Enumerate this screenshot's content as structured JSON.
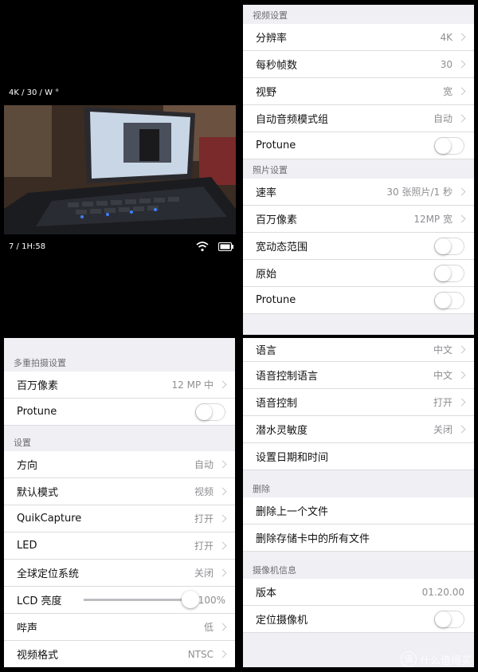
{
  "camera": {
    "mode_info": "4K / 30 / W °",
    "status_info": "7 / 1H:58",
    "wifi_icon": "wifi-icon",
    "battery_icon": "battery-icon"
  },
  "video_settings": {
    "header": "视频设置",
    "rows": [
      {
        "label": "分辨率",
        "value": "4K"
      },
      {
        "label": "每秒帧数",
        "value": "30"
      },
      {
        "label": "视野",
        "value": "宽"
      },
      {
        "label": "自动音频模式组",
        "value": "自动"
      }
    ],
    "protune_label": "Protune"
  },
  "photo_settings": {
    "header": "照片设置",
    "rows": [
      {
        "label": "速率",
        "value": "30 张照片/1 秒"
      },
      {
        "label": "百万像素",
        "value": "12MP 宽"
      }
    ],
    "toggles": [
      "宽动态范围",
      "原始",
      "Protune"
    ]
  },
  "multishot_settings": {
    "header": "多重拍摄设置",
    "megapixel_label": "百万像素",
    "megapixel_value": "12 MP 中",
    "protune_label": "Protune"
  },
  "settings": {
    "header": "设置",
    "rows": [
      {
        "label": "方向",
        "value": "自动"
      },
      {
        "label": "默认模式",
        "value": "视频"
      },
      {
        "label": "QuikCapture",
        "value": "打开"
      },
      {
        "label": "LED",
        "value": "打开"
      },
      {
        "label": "全球定位系统",
        "value": "关闭"
      }
    ],
    "lcd_label": "LCD 亮度",
    "lcd_value": "100%",
    "lcd_level": 1.0,
    "beep_label": "哔声",
    "beep_value": "低",
    "video_format_label": "视频格式",
    "video_format_value": "NTSC"
  },
  "general": {
    "rows": [
      {
        "label": "语言",
        "value": "中文"
      },
      {
        "label": "语音控制语言",
        "value": "中文"
      },
      {
        "label": "语音控制",
        "value": "打开"
      },
      {
        "label": "潜水灵敏度",
        "value": "关闭"
      }
    ],
    "datetime_label": "设置日期和时间"
  },
  "delete_section": {
    "header": "删除",
    "rows": [
      "删除上一个文件",
      "删除存储卡中的所有文件"
    ]
  },
  "camera_info": {
    "header": "摄像机信息",
    "version_label": "版本",
    "version_value": "01.20.00",
    "locate_label": "定位摄像机"
  },
  "watermark": {
    "logo_char": "值",
    "text": "什么值得买"
  }
}
